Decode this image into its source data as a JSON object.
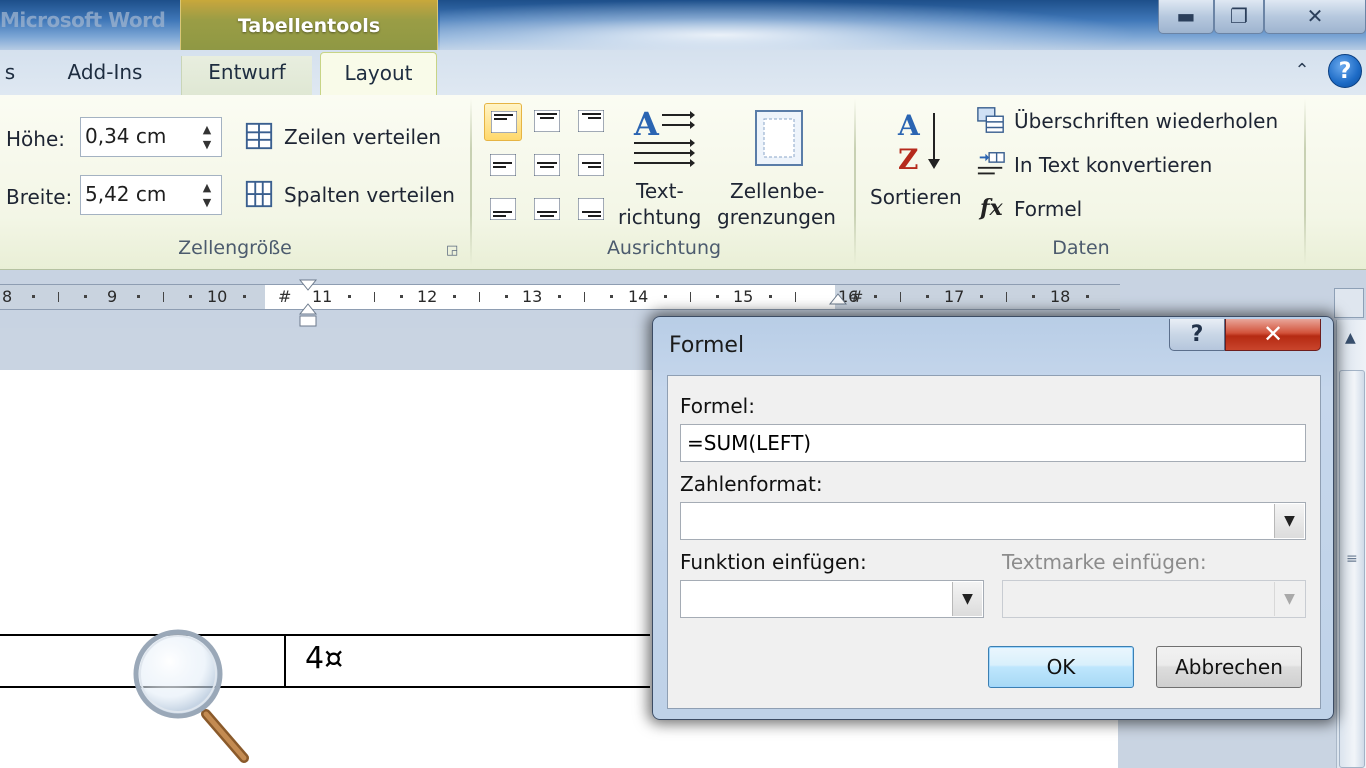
{
  "window": {
    "app_title": "Microsoft Word",
    "context_tab_group": "Tabellentools",
    "controls": {
      "minimize": "▬",
      "maximize": "❐",
      "close": "✕"
    }
  },
  "tabs": [
    {
      "label": "s"
    },
    {
      "label": "Add-Ins"
    },
    {
      "label": "Entwurf"
    },
    {
      "label": "Layout",
      "active": true
    }
  ],
  "ribbon": {
    "collapse_glyph": "⌃",
    "help_glyph": "?",
    "cell_size": {
      "height_label": "Höhe:",
      "height_value": "0,34  cm",
      "width_label": "Breite:",
      "width_value": "5,42  cm",
      "distribute_rows": "Zeilen verteilen",
      "distribute_columns": "Spalten verteilen",
      "group_label": "Zellengröße"
    },
    "alignment": {
      "text_direction_line1": "Text-",
      "text_direction_line2": "richtung",
      "cell_margins_line1": "Zellenbe-",
      "cell_margins_line2": "grenzungen",
      "group_label": "Ausrichtung"
    },
    "data": {
      "sort": "Sortieren",
      "repeat_headers": "Überschriften wiederholen",
      "convert_to_text": "In Text konvertieren",
      "formula": "Formel",
      "group_label": "Daten"
    }
  },
  "ruler": {
    "numbers": [
      "8",
      "9",
      "10",
      "11",
      "12",
      "13",
      "14",
      "15",
      "16",
      "17",
      "18"
    ]
  },
  "document": {
    "cell_value": "4¤"
  },
  "dialog": {
    "title": "Formel",
    "help_glyph": "?",
    "close_glyph": "✕",
    "formula_label": "Formel:",
    "formula_value": "=SUM(LEFT)",
    "number_format_label": "Zahlenformat:",
    "number_format_value": "",
    "paste_function_label": "Funktion einfügen:",
    "paste_function_value": "",
    "paste_bookmark_label": "Textmarke einfügen:",
    "paste_bookmark_value": "",
    "ok_label": "OK",
    "cancel_label": "Abbrechen"
  }
}
